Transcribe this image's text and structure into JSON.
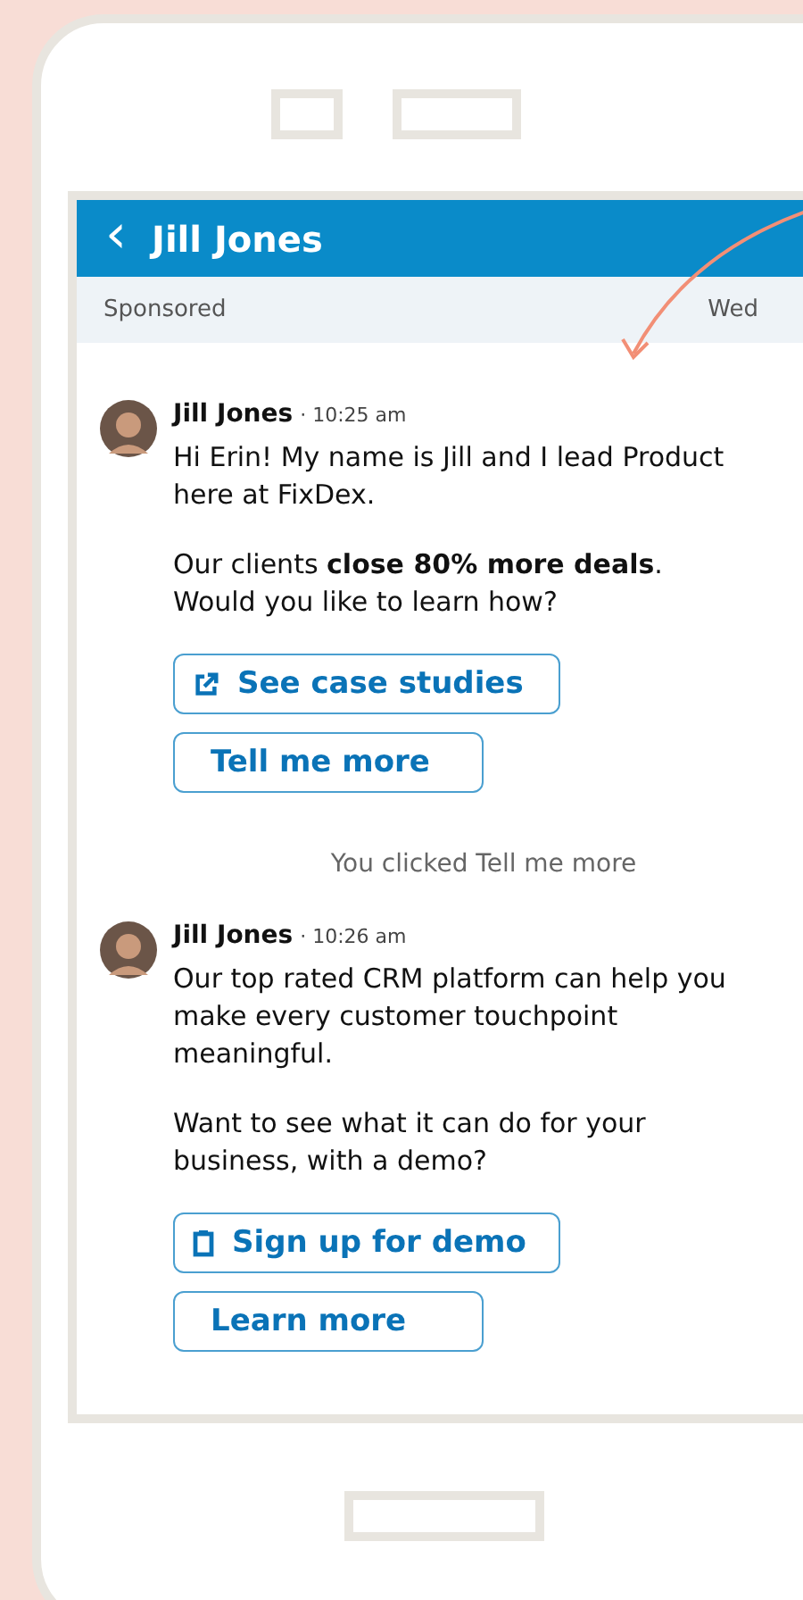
{
  "header": {
    "back_icon": "‹",
    "title": "Jill Jones"
  },
  "sub_bar": {
    "label": "Sponsored",
    "date": "Wed"
  },
  "thread": [
    {
      "kind": "message",
      "sender": "Jill Jones",
      "time": "· 10:25 am",
      "paragraphs": [
        "Hi Erin! My name is Jill and I lead Product here at FixDex.",
        "Our clients **close 80% more deals**. Would you like to learn how?"
      ],
      "buttons": [
        {
          "label": "See case studies",
          "kind": "link"
        },
        {
          "label": "Tell me more",
          "kind": "reply"
        }
      ]
    },
    {
      "kind": "notice",
      "text": "You clicked Tell me more"
    },
    {
      "kind": "message",
      "sender": "Jill Jones",
      "time": "· 10:26 am",
      "paragraphs": [
        "Our top rated CRM platform can help you make every customer touchpoint meaningful.",
        "Want to see what it can do for your business, with a demo?"
      ],
      "buttons": [
        {
          "label": "Sign up for demo",
          "kind": "form"
        },
        {
          "label": "Learn more",
          "kind": "reply"
        }
      ]
    }
  ]
}
